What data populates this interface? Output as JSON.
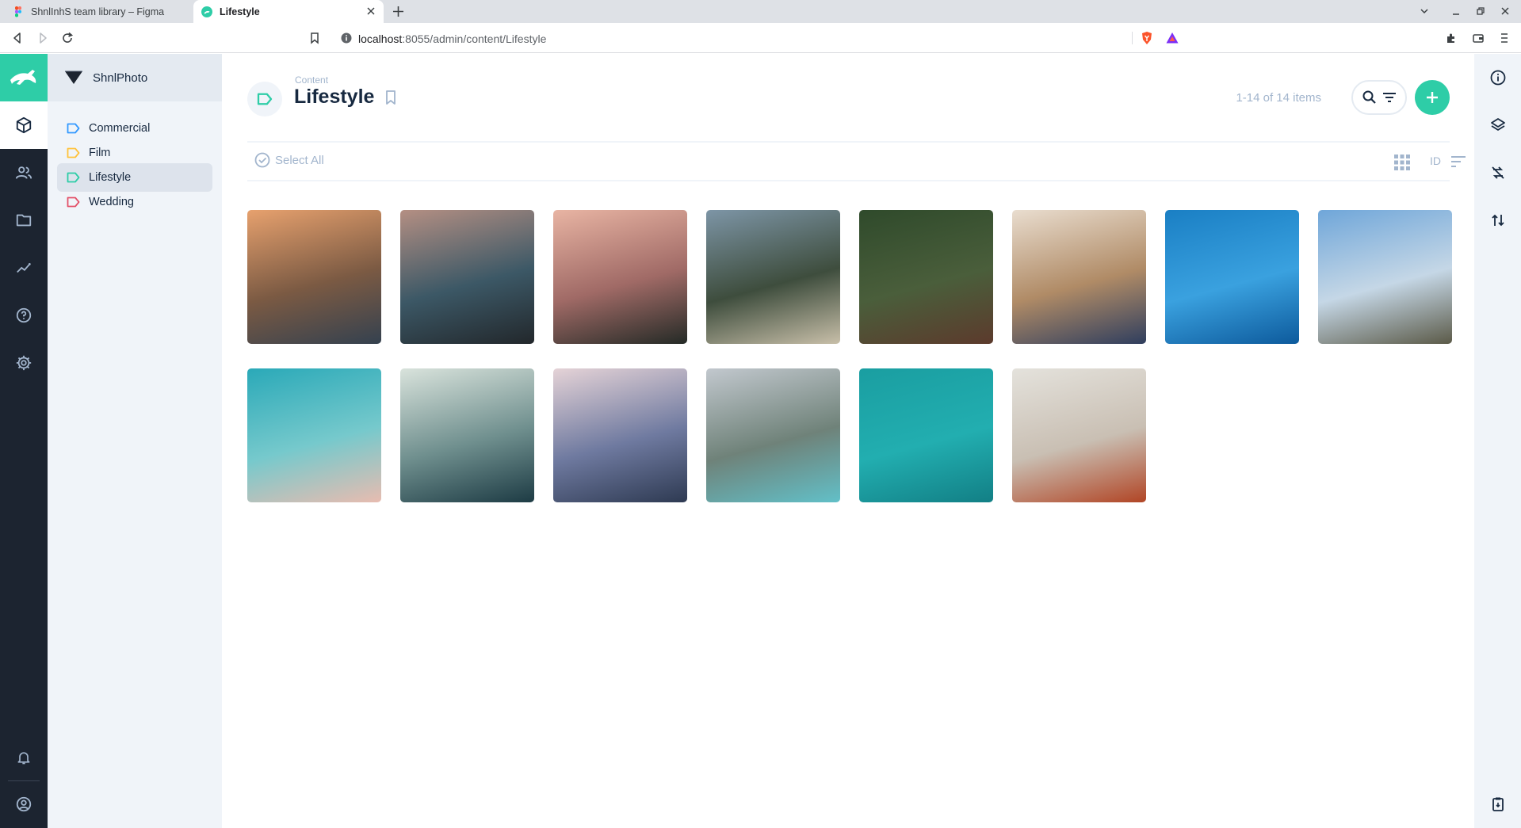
{
  "browser": {
    "tabs": [
      {
        "title": "ShnlInhS team library – Figma",
        "active": false
      },
      {
        "title": "Lifestyle",
        "active": true
      }
    ],
    "url_host": "localhost",
    "url_path": ":8055/admin/content/Lifestyle"
  },
  "project": {
    "name": "ShnlPhoto"
  },
  "nav": {
    "items": [
      {
        "label": "Commercial",
        "color": "#3399ff"
      },
      {
        "label": "Film",
        "color": "#ffc23b"
      },
      {
        "label": "Lifestyle",
        "color": "#2ecda7",
        "active": true
      },
      {
        "label": "Wedding",
        "color": "#e35169"
      }
    ]
  },
  "header": {
    "breadcrumb": "Content",
    "title": "Lifestyle",
    "count": "1-14 of 14 items"
  },
  "toolbar": {
    "select_all": "Select All",
    "sort_field": "ID"
  },
  "gallery": {
    "items": [
      {
        "name": "guitar-friends-street",
        "colors": [
          "#e7a16e",
          "#7b5a43",
          "#34414f"
        ]
      },
      {
        "name": "man-rocky-coast",
        "colors": [
          "#b48f83",
          "#3c5866",
          "#22272b"
        ]
      },
      {
        "name": "silhouette-sunset",
        "colors": [
          "#e8b4a3",
          "#a06a66",
          "#242a26"
        ]
      },
      {
        "name": "palm-trees-beach",
        "colors": [
          "#7d95a6",
          "#3e4d3d",
          "#c8bfa9"
        ]
      },
      {
        "name": "hikers-forest-trail",
        "colors": [
          "#2f4a2b",
          "#4a5e3b",
          "#5c3a2c"
        ]
      },
      {
        "name": "breakfast-tray",
        "colors": [
          "#e9ddcf",
          "#b08b66",
          "#2f3e5e"
        ]
      },
      {
        "name": "surfer-blue-wave",
        "colors": [
          "#1a7fc4",
          "#3aa1df",
          "#0d5a9c"
        ]
      },
      {
        "name": "man-cliff-ocean",
        "colors": [
          "#6fa6d9",
          "#c5d7e6",
          "#5b5a48"
        ]
      },
      {
        "name": "surfboard-shoreline",
        "colors": [
          "#2aa9b8",
          "#76c9cc",
          "#e8bcb0"
        ]
      },
      {
        "name": "surfer-in-water",
        "colors": [
          "#d9e3dc",
          "#6f8f8e",
          "#1d3b44"
        ]
      },
      {
        "name": "friends-cheering-sunset",
        "colors": [
          "#e5d3d7",
          "#6f7aa0",
          "#2e3a52"
        ]
      },
      {
        "name": "mountain-lake",
        "colors": [
          "#c2c8ce",
          "#6f8279",
          "#62c0c8"
        ]
      },
      {
        "name": "float-teal-water",
        "colors": [
          "#1a9ea1",
          "#22aeb0",
          "#127f85"
        ]
      },
      {
        "name": "woman-laptop-sofa",
        "colors": [
          "#e4e2dc",
          "#c9bfb3",
          "#b14525"
        ]
      }
    ]
  }
}
